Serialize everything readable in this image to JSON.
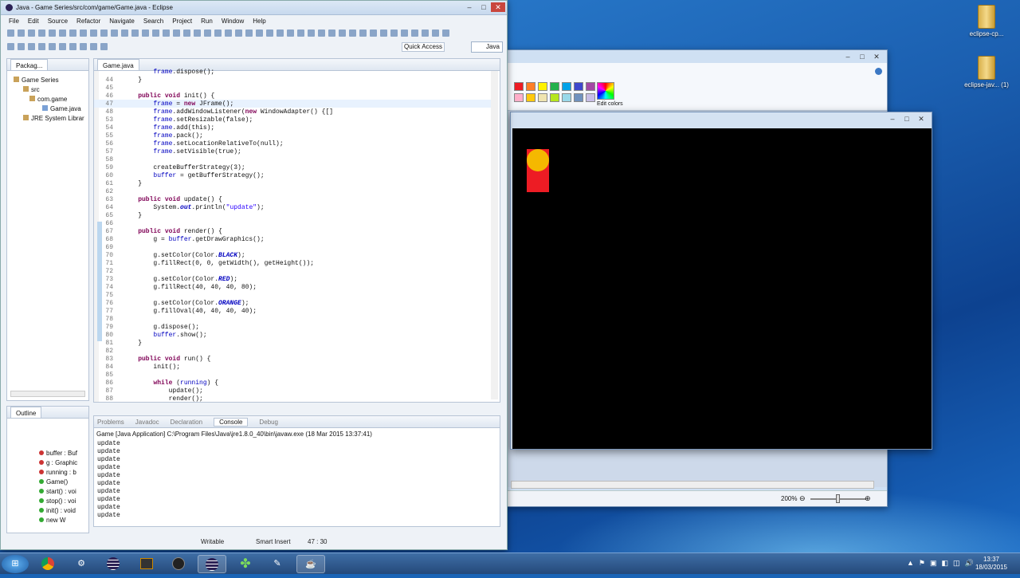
{
  "desktop": {
    "icons": [
      {
        "label": "eclipse-cp..."
      },
      {
        "label": "eclipse-jav... (1)"
      }
    ]
  },
  "eclipse": {
    "title": "Java - Game Series/src/com/game/Game.java - Eclipse",
    "menu": [
      "File",
      "Edit",
      "Source",
      "Refactor",
      "Navigate",
      "Search",
      "Project",
      "Run",
      "Window",
      "Help"
    ],
    "quick_access": "Quick Access",
    "perspective": "Java",
    "package_explorer": {
      "tab": "Packag...",
      "items": [
        "Game Series",
        "src",
        "com.game",
        "Game.java",
        "JRE System Librar"
      ]
    },
    "editor": {
      "tab": "Game.java",
      "lines": [
        {
          "n": "",
          "t": "        frame.dispose();"
        },
        {
          "n": "44",
          "t": "    }"
        },
        {
          "n": "45",
          "t": ""
        },
        {
          "n": "46",
          "t": "    public void init() {"
        },
        {
          "n": "47",
          "t": "        frame = new JFrame();"
        },
        {
          "n": "48",
          "t": "        frame.addWindowListener(new WindowAdapter() {[]"
        },
        {
          "n": "53",
          "t": "        frame.setResizable(false);"
        },
        {
          "n": "54",
          "t": "        frame.add(this);"
        },
        {
          "n": "55",
          "t": "        frame.pack();"
        },
        {
          "n": "56",
          "t": "        frame.setLocationRelativeTo(null);"
        },
        {
          "n": "57",
          "t": "        frame.setVisible(true);"
        },
        {
          "n": "58",
          "t": ""
        },
        {
          "n": "59",
          "t": "        createBufferStrategy(3);"
        },
        {
          "n": "60",
          "t": "        buffer = getBufferStrategy();"
        },
        {
          "n": "61",
          "t": "    }"
        },
        {
          "n": "62",
          "t": ""
        },
        {
          "n": "63",
          "t": "    public void update() {"
        },
        {
          "n": "64",
          "t": "        System.out.println(\"update\");"
        },
        {
          "n": "65",
          "t": "    }"
        },
        {
          "n": "66",
          "t": ""
        },
        {
          "n": "67",
          "t": "    public void render() {"
        },
        {
          "n": "68",
          "t": "        g = buffer.getDrawGraphics();"
        },
        {
          "n": "69",
          "t": ""
        },
        {
          "n": "70",
          "t": "        g.setColor(Color.BLACK);"
        },
        {
          "n": "71",
          "t": "        g.fillRect(0, 0, getWidth(), getHeight());"
        },
        {
          "n": "72",
          "t": ""
        },
        {
          "n": "73",
          "t": "        g.setColor(Color.RED);"
        },
        {
          "n": "74",
          "t": "        g.fillRect(40, 40, 40, 80);"
        },
        {
          "n": "75",
          "t": ""
        },
        {
          "n": "76",
          "t": "        g.setColor(Color.ORANGE);"
        },
        {
          "n": "77",
          "t": "        g.fillOval(40, 40, 40, 40);"
        },
        {
          "n": "78",
          "t": ""
        },
        {
          "n": "79",
          "t": "        g.dispose();"
        },
        {
          "n": "80",
          "t": "        buffer.show();"
        },
        {
          "n": "81",
          "t": "    }"
        },
        {
          "n": "82",
          "t": ""
        },
        {
          "n": "83",
          "t": "    public void run() {"
        },
        {
          "n": "84",
          "t": "        init();"
        },
        {
          "n": "85",
          "t": ""
        },
        {
          "n": "86",
          "t": "        while (running) {"
        },
        {
          "n": "87",
          "t": "            update();"
        },
        {
          "n": "88",
          "t": "            render();"
        }
      ]
    },
    "outline": {
      "tab": "Outline",
      "items": [
        "buffer : Buf",
        "g : Graphic",
        "running : b",
        "Game()",
        "start() : voi",
        "stop() : voi",
        "init() : void",
        "new W"
      ]
    },
    "bottom_tabs": [
      "Problems",
      "Javadoc",
      "Declaration",
      "Console",
      "Debug"
    ],
    "console": {
      "header": "Game [Java Application] C:\\Program Files\\Java\\jre1.8.0_40\\bin\\javaw.exe (18 Mar 2015 13:37:41)",
      "lines": [
        "update",
        "update",
        "update",
        "update",
        "update",
        "update",
        "update",
        "update",
        "update",
        "update"
      ]
    },
    "status": {
      "writable": "Writable",
      "insert": "Smart Insert",
      "position": "47 : 30"
    }
  },
  "paint": {
    "edit_colors": "Edit colors",
    "zoom": "200%",
    "palette_top": [
      "#ed1c24",
      "#ff7f27",
      "#fff200",
      "#22b14c",
      "#00a2e8",
      "#3f48cc",
      "#a349a4"
    ],
    "palette_bottom": [
      "#ffaec9",
      "#ffc90e",
      "#efe4b0",
      "#b5e61d",
      "#99d9ea",
      "#7092be",
      "#c8bfe7"
    ]
  },
  "game": {
    "colors": {
      "background": "#000000",
      "rect": "#ed1c24",
      "oval": "#f5b800"
    }
  },
  "taskbar": {
    "clock_time": "13:37",
    "clock_date": "18/03/2015"
  }
}
